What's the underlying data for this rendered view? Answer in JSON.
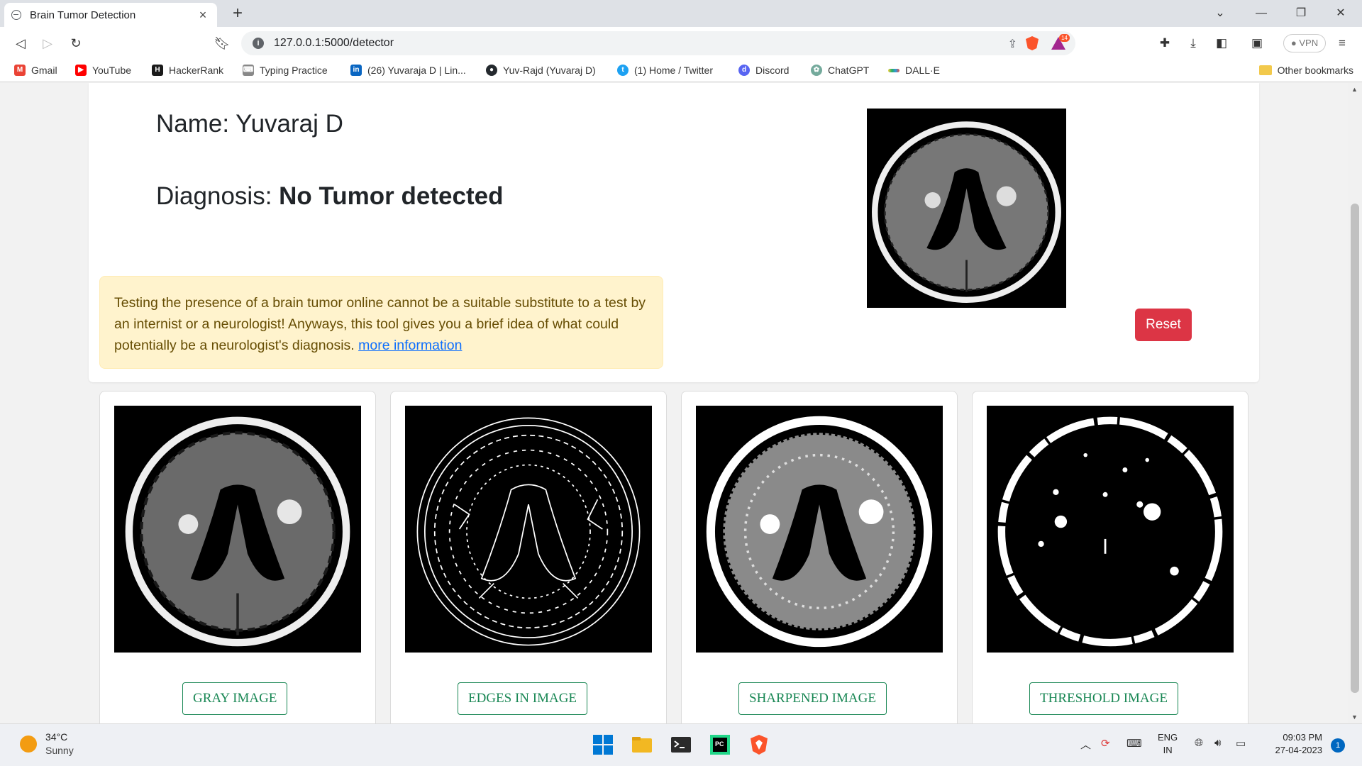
{
  "browser": {
    "tab_title": "Brain Tumor Detection",
    "url": "127.0.0.1:5000/detector",
    "vpn_label": "VPN",
    "rewards_badge": "14"
  },
  "bookmarks": [
    {
      "label": "Gmail",
      "icon": "gmail-icon",
      "color": "#ea4335"
    },
    {
      "label": "YouTube",
      "icon": "youtube-icon",
      "color": "#ff0000"
    },
    {
      "label": "HackerRank",
      "icon": "hackerrank-icon",
      "color": "#1a1a1a"
    },
    {
      "label": "Typing Practice",
      "icon": "keyboard-icon",
      "color": "#888888"
    },
    {
      "label": "(26) Yuvaraja D | Lin...",
      "icon": "linkedin-icon",
      "color": "#0a66c2"
    },
    {
      "label": "Yuv-Rajd (Yuvaraj D)",
      "icon": "github-icon",
      "color": "#24292e"
    },
    {
      "label": "(1) Home / Twitter",
      "icon": "twitter-icon",
      "color": "#1da1f2"
    },
    {
      "label": "Discord",
      "icon": "discord-icon",
      "color": "#5865f2"
    },
    {
      "label": "ChatGPT",
      "icon": "chatgpt-icon",
      "color": "#74aa9c"
    },
    {
      "label": "DALL·E",
      "icon": "dalle-icon",
      "color": "#e8a317"
    }
  ],
  "other_bookmarks": "Other bookmarks",
  "result": {
    "name_line": "Name: Yuvaraj D",
    "diagnosis_label": "Diagnosis: ",
    "diagnosis_value": "No Tumor detected",
    "disclaimer": "Testing the presence of a brain tumor online cannot be a suitable substitute to a test by an internist or a neurologist! Anyways, this tool gives you a brief idea of what could potentially be a neurologist's diagnosis. ",
    "more_info_link": "more information",
    "reset_label": "Reset"
  },
  "image_cards": [
    {
      "label": "GRAY IMAGE"
    },
    {
      "label": "EDGES IN IMAGE"
    },
    {
      "label": "SHARPENED IMAGE"
    },
    {
      "label": "THRESHOLD IMAGE"
    }
  ],
  "colors": {
    "danger": "#dc3545",
    "success": "#198754",
    "alert_bg": "#fff3cd",
    "link": "#0d6efd"
  },
  "taskbar": {
    "temperature": "34°C",
    "weather": "Sunny",
    "lang_top": "ENG",
    "lang_bottom": "IN",
    "time": "09:03 PM",
    "date": "27-04-2023",
    "notifications": "1"
  }
}
